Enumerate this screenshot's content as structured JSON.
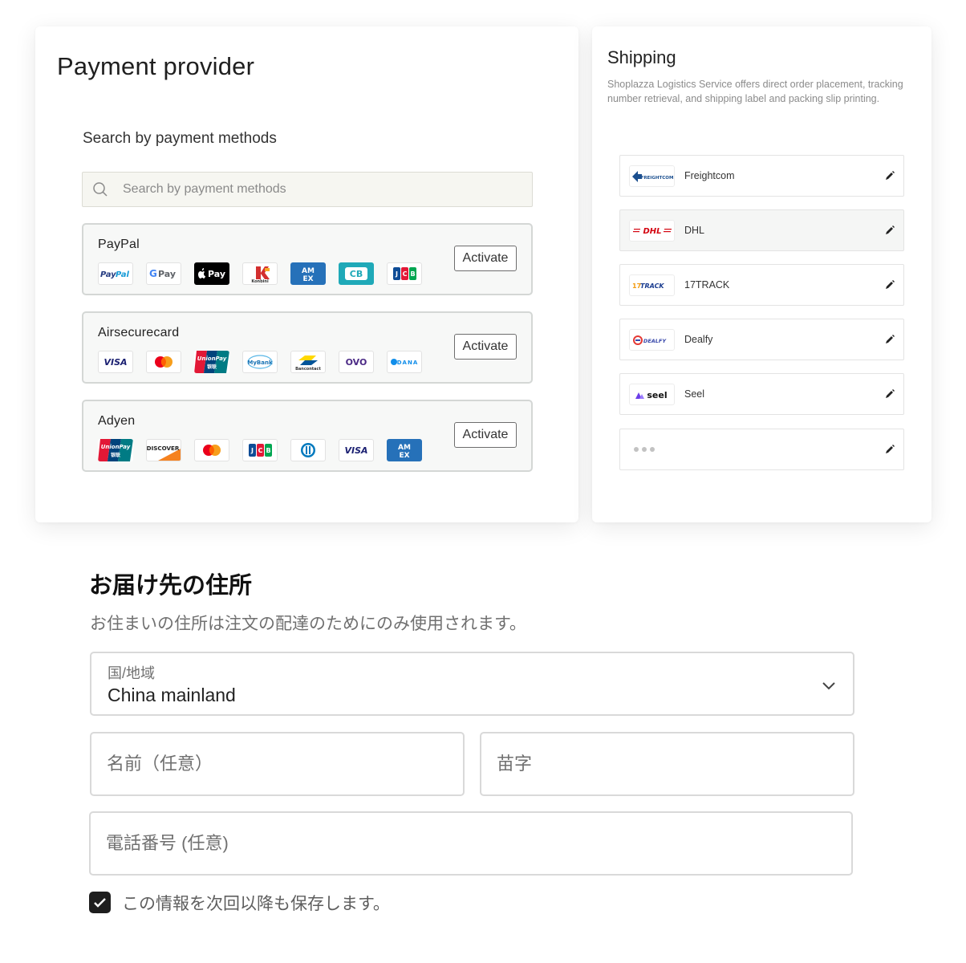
{
  "payment": {
    "title": "Payment provider",
    "search_label": "Search by payment methods",
    "search_placeholder": "Search by payment methods",
    "activate_label": "Activate",
    "providers": [
      {
        "name": "PayPal",
        "methods": [
          "PayPal",
          "G Pay",
          "Apple Pay",
          "Konbini",
          "American Express",
          "CB",
          "JCB"
        ]
      },
      {
        "name": "Airsecurecard",
        "methods": [
          "VISA",
          "Mastercard",
          "UnionPay",
          "MyBank",
          "Bancontact",
          "OVO",
          "DANA"
        ]
      },
      {
        "name": "Adyen",
        "methods": [
          "UnionPay",
          "DISCOVER",
          "Mastercard",
          "JCB",
          "Diners Club",
          "VISA",
          "American Express"
        ]
      }
    ]
  },
  "shipping": {
    "title": "Shipping",
    "description": "Shoplazza Logistics Service offers direct order placement, tracking number retrieval, and shipping label and packing slip printing.",
    "carriers": [
      {
        "name": "Freightcom",
        "logo_text": "FREIGHTCOM"
      },
      {
        "name": "DHL",
        "logo_text": "DHL"
      },
      {
        "name": "17TRACK",
        "logo_text": "17TRACK"
      },
      {
        "name": "Dealfy",
        "logo_text": "DEALFY"
      },
      {
        "name": "Seel",
        "logo_text": "seel"
      }
    ]
  },
  "address": {
    "title": "お届け先の住所",
    "subtitle": "お住まいの住所は注文の配達のためにのみ使用されます。",
    "country_label": "国/地域",
    "country_value": "China mainland",
    "first_name_placeholder": "名前（任意）",
    "last_name_placeholder": "苗字",
    "phone_placeholder": "電話番号 (任意)",
    "save_label": "この情報を次回以降も保存します。",
    "save_checked": true
  },
  "colors": {
    "provider_bg": "#f7f8f7",
    "dhl_red": "#d40511",
    "checkbox": "#1e1e1e"
  }
}
